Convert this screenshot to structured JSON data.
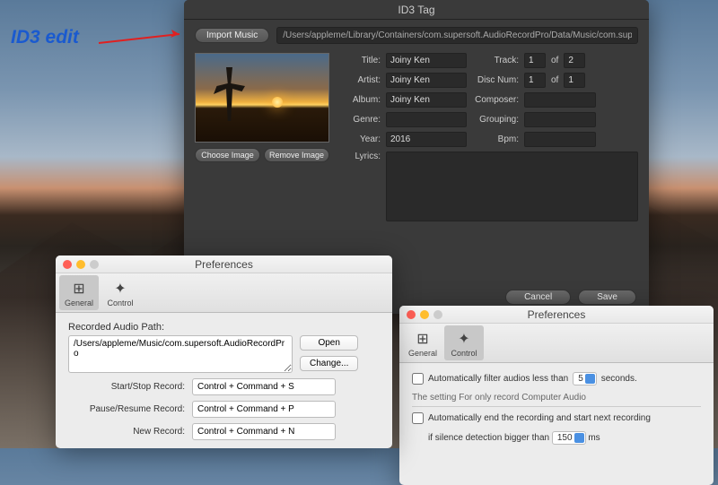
{
  "annotation": "ID3 edit",
  "id3": {
    "title": "ID3 Tag",
    "import_btn": "Import Music",
    "path": "/Users/appleme/Library/Containers/com.supersoft.AudioRecordPro/Data/Music/com.super",
    "choose_img": "Choose Image",
    "remove_img": "Remove Image",
    "labels": {
      "title": "Title:",
      "artist": "Artist:",
      "album": "Album:",
      "genre": "Genre:",
      "year": "Year:",
      "lyrics": "Lyrics:",
      "track": "Track:",
      "of": "of",
      "discnum": "Disc Num:",
      "composer": "Composer:",
      "grouping": "Grouping:",
      "bpm": "Bpm:"
    },
    "values": {
      "title": "Joiny Ken",
      "artist": "Joiny Ken",
      "album": "Joiny Ken",
      "genre": "",
      "year": "2016",
      "track": "1",
      "track_of": "2",
      "disc": "1",
      "disc_of": "1",
      "composer": "",
      "grouping": "",
      "bpm": ""
    },
    "cancel": "Cancel",
    "save": "Save"
  },
  "pref1": {
    "title": "Preferences",
    "tabs": {
      "general": "General",
      "control": "Control"
    },
    "path_label": "Recorded Audio Path:",
    "path_value": "/Users/appleme/Music/com.supersoft.AudioRecordPro",
    "open_btn": "Open",
    "change_btn": "Change...",
    "shortcuts": {
      "start_label": "Start/Stop Record:",
      "start_val": "Control + Command + S",
      "pause_label": "Pause/Resume Record:",
      "pause_val": "Control + Command + P",
      "new_label": "New Record:",
      "new_val": "Control + Command + N"
    }
  },
  "pref2": {
    "title": "Preferences",
    "tabs": {
      "general": "General",
      "control": "Control"
    },
    "filter_pre": "Automatically filter audios less than",
    "filter_val": "5",
    "filter_post": "seconds.",
    "group_label": "The setting For only record Computer Audio",
    "auto_end": "Automatically  end the recording and start next recording",
    "silence_pre": "if silence detection bigger than",
    "silence_val": "150",
    "silence_post": "ms"
  }
}
